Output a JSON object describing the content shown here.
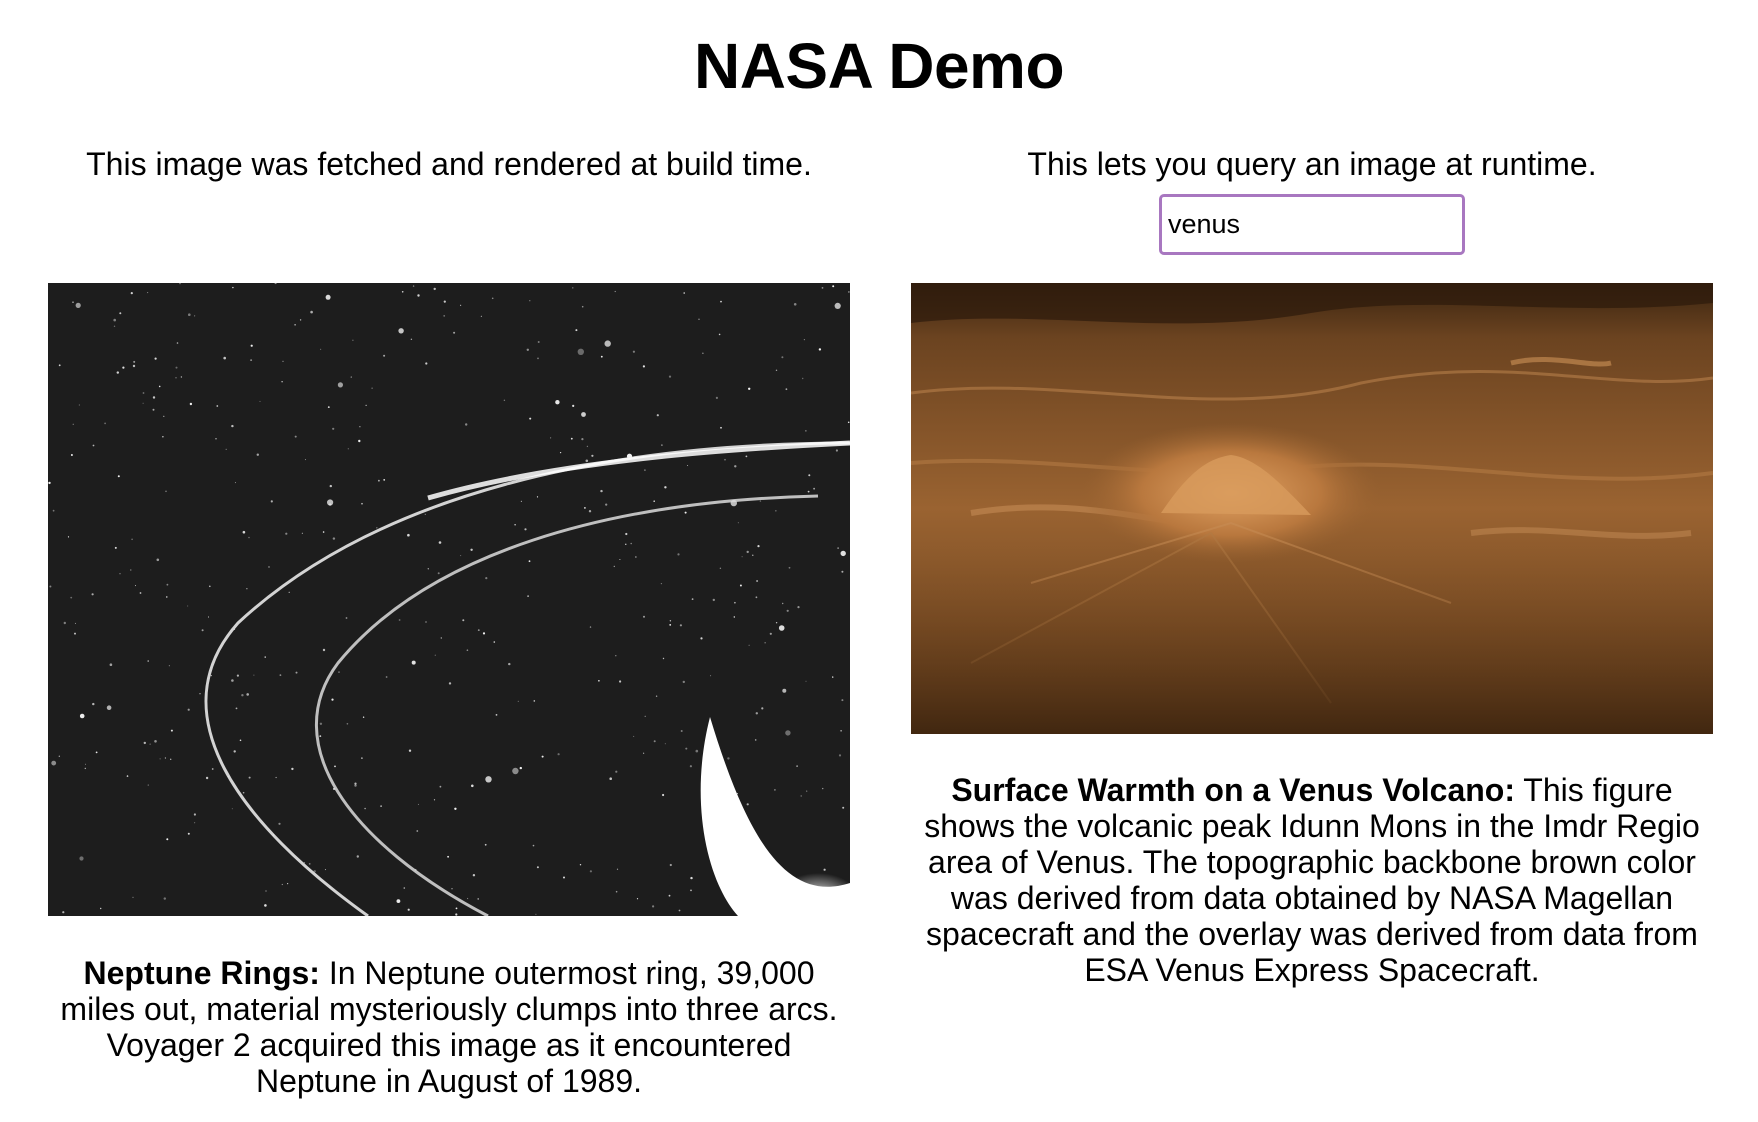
{
  "page": {
    "title": "NASA Demo"
  },
  "left_panel": {
    "intro": "This image was fetched and rendered at build time.",
    "image_title": "Neptune Rings:",
    "image_description": "In Neptune outermost ring, 39,000 miles out, material mysteriously clumps into three arcs. Voyager 2 acquired this image as it encountered Neptune in August of 1989."
  },
  "right_panel": {
    "intro": "This lets you query an image at runtime.",
    "search_value": "venus",
    "image_title": "Surface Warmth on a Venus Volcano:",
    "image_description": "This figure shows the volcanic peak Idunn Mons in the Imdr Regio area of Venus. The topographic backbone brown color was derived from data obtained by NASA Magellan spacecraft and the overlay was derived from data from ESA Venus Express Spacecraft."
  },
  "colors": {
    "input_border": "#a877c0",
    "neptune_bg": "#1d1d1d",
    "venus_surface": "#8a5628"
  }
}
